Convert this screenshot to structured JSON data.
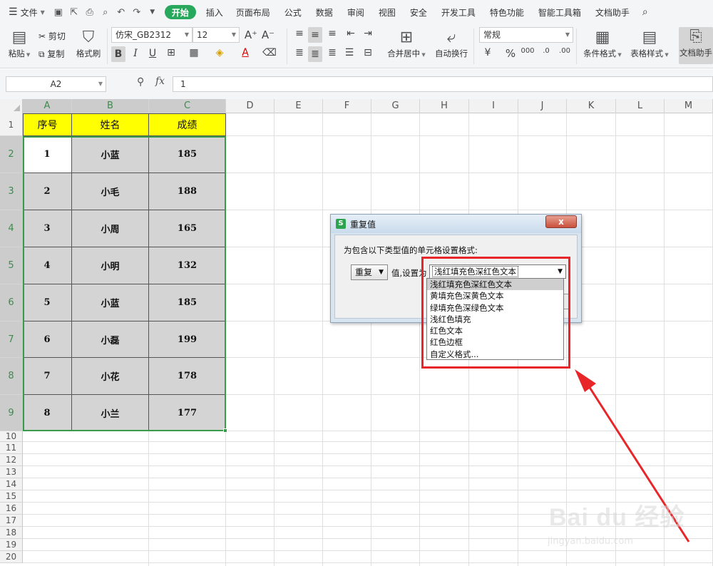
{
  "menubar": {
    "file_label": "文件",
    "tabs": [
      "开始",
      "插入",
      "页面布局",
      "公式",
      "数据",
      "审阅",
      "视图",
      "安全",
      "开发工具",
      "特色功能",
      "智能工具箱",
      "文档助手"
    ],
    "active_tab": "开始"
  },
  "ribbon": {
    "paste": "粘贴",
    "cut": "剪切",
    "copy": "复制",
    "format_painter": "格式刷",
    "font_name": "仿宋_GB2312",
    "font_size": "12",
    "merge_center": "合并居中",
    "wrap_text": "自动换行",
    "number_format": "常规",
    "conditional_format": "条件格式",
    "table_style": "表格样式",
    "doc_helper": "文档助手"
  },
  "formula_bar": {
    "name_box": "A2",
    "fx_label": "fx",
    "value": "1"
  },
  "columns": [
    "A",
    "B",
    "C",
    "D",
    "E",
    "F",
    "G",
    "H",
    "I",
    "J",
    "K",
    "L",
    "M"
  ],
  "rows": [
    "1",
    "2",
    "3",
    "4",
    "5",
    "6",
    "7",
    "8",
    "9",
    "10",
    "11",
    "12",
    "13",
    "14",
    "15",
    "16",
    "17",
    "18",
    "19",
    "20"
  ],
  "table": {
    "headers": [
      "序号",
      "姓名",
      "成绩"
    ],
    "rows": [
      [
        "1",
        "小蓝",
        "185"
      ],
      [
        "2",
        "小毛",
        "188"
      ],
      [
        "3",
        "小周",
        "165"
      ],
      [
        "4",
        "小明",
        "132"
      ],
      [
        "5",
        "小蓝",
        "185"
      ],
      [
        "6",
        "小磊",
        "199"
      ],
      [
        "7",
        "小花",
        "178"
      ],
      [
        "8",
        "小兰",
        "177"
      ]
    ]
  },
  "dialog": {
    "title": "重复值",
    "close": "x",
    "prompt": "为包含以下类型值的单元格设置格式:",
    "condition": "重复",
    "mid_label": "值,设置为",
    "format_value": "浅红填充色深红色文本",
    "options": [
      "浅红填充色深红色文本",
      "黄填充色深黄色文本",
      "绿填充色深绿色文本",
      "浅红色填充",
      "红色文本",
      "红色边框",
      "自定义格式..."
    ]
  },
  "watermark": {
    "brand": "Bai du 经验",
    "url": "jingyan.baidu.com"
  },
  "colors": {
    "accent_green": "#27a85c",
    "header_fill": "#ffff00",
    "cell_fill": "#d4d4d4",
    "annotation_red": "#e8262a"
  }
}
